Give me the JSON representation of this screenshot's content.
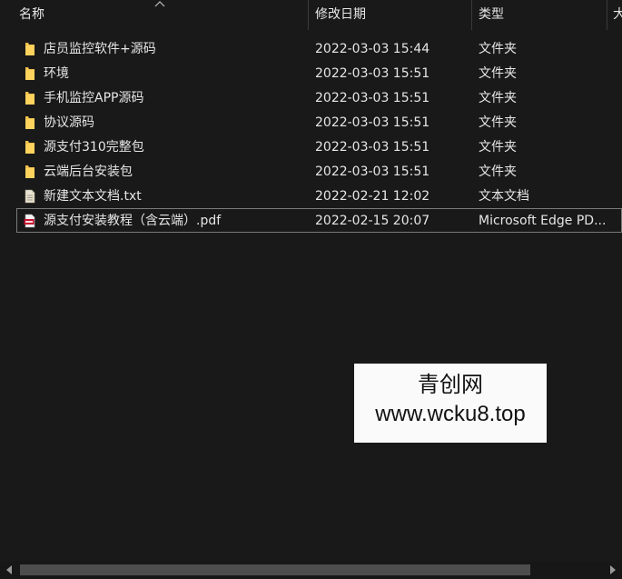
{
  "columns": {
    "name": "名称",
    "date": "修改日期",
    "type": "类型",
    "size": "大"
  },
  "files": [
    {
      "name": "店员监控软件+源码",
      "date": "2022-03-03 15:44",
      "type": "文件夹",
      "icon": "folder-icon"
    },
    {
      "name": "环境",
      "date": "2022-03-03 15:51",
      "type": "文件夹",
      "icon": "folder-icon"
    },
    {
      "name": "手机监控APP源码",
      "date": "2022-03-03 15:51",
      "type": "文件夹",
      "icon": "folder-icon"
    },
    {
      "name": "协议源码",
      "date": "2022-03-03 15:51",
      "type": "文件夹",
      "icon": "folder-icon"
    },
    {
      "name": "源支付310完整包",
      "date": "2022-03-03 15:51",
      "type": "文件夹",
      "icon": "folder-icon"
    },
    {
      "name": "云端后台安装包",
      "date": "2022-03-03 15:51",
      "type": "文件夹",
      "icon": "folder-icon"
    },
    {
      "name": "新建文本文档.txt",
      "date": "2022-02-21 12:02",
      "type": "文本文档",
      "icon": "text-file-icon"
    },
    {
      "name": "源支付安装教程（含云端）.pdf",
      "date": "2022-02-15 20:07",
      "type": "Microsoft Edge PD...",
      "icon": "pdf-file-icon"
    }
  ],
  "watermark": {
    "line1": "青创网",
    "line2": "www.wcku8.top"
  },
  "colors": {
    "background": "#191919",
    "folder": "#f2c14e",
    "pdf": "#c8102e"
  }
}
